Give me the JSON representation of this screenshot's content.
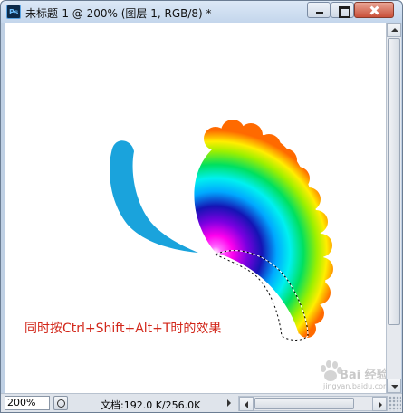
{
  "window": {
    "app_icon": "photoshop-icon",
    "title": "未标题-1 @ 200% (图层 1, RGB/8) *",
    "controls": [
      "minimize-icon",
      "maximize-icon",
      "close-icon"
    ]
  },
  "canvas": {
    "caption": "同时按Ctrl+Shift+Alt+T时的效果",
    "colors": {
      "blue_stroke": "#1aa3dc",
      "caption": "#d2271a",
      "selection_outline": "#000000"
    },
    "watermark": {
      "logo": "Bai 经验",
      "url": "jingyan.baidu.com"
    }
  },
  "status": {
    "zoom": "200%",
    "doc_info": "文档:192.0 K/256.0K"
  }
}
